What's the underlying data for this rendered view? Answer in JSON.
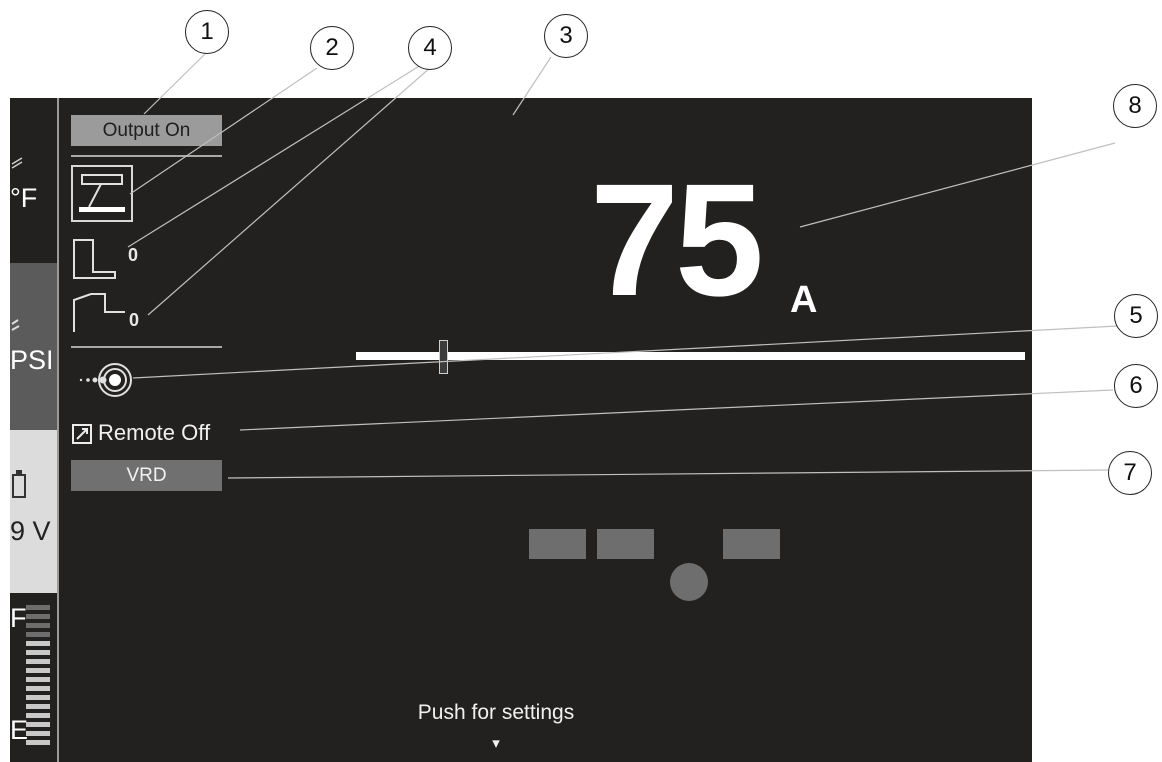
{
  "sidebar": {
    "temp_unit": "°F",
    "pressure_unit": "PSI",
    "voltage": "9 V",
    "gauge_top": "F",
    "gauge_bottom": "E"
  },
  "screen": {
    "output_label": "Output On",
    "start_value": "0",
    "end_value": "0",
    "remote_label": "Remote Off",
    "vrd_label": "VRD",
    "current_value": "75",
    "current_unit": "A",
    "current_slider_level": 0.13,
    "footer_hint": "Push for settings",
    "footer_arrow": "▾"
  },
  "icons": [
    "electrode-holder-icon",
    "hot-start-icon",
    "arc-force-icon",
    "arc-icon",
    "remote-icon"
  ],
  "callouts": [
    "1",
    "2",
    "3",
    "4",
    "5",
    "6",
    "7",
    "8"
  ],
  "colors": {
    "screen_bg": "#232120",
    "output_button": "#9b9b9b",
    "vrd_button": "#707070",
    "slider": "#ffffff"
  }
}
